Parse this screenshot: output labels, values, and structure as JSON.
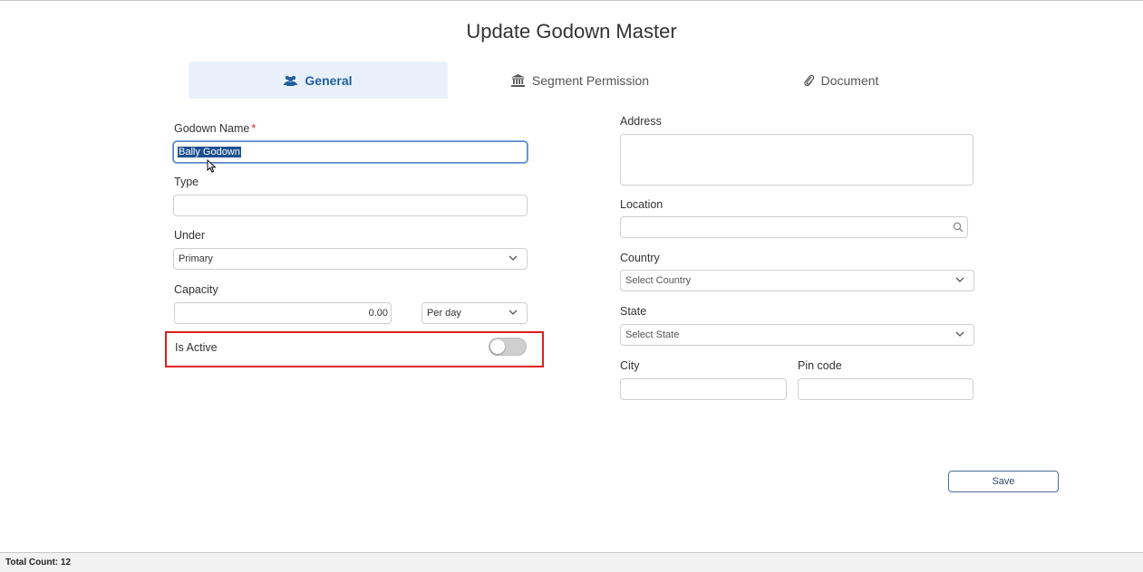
{
  "page": {
    "title": "Update Godown Master"
  },
  "tabs": [
    {
      "label": "General",
      "icon": "users-icon",
      "active": true
    },
    {
      "label": "Segment Permission",
      "icon": "bank-icon",
      "active": false
    },
    {
      "label": "Document",
      "icon": "paperclip-icon",
      "active": false
    }
  ],
  "left": {
    "godown_name": {
      "label": "Godown Name",
      "required_mark": "*",
      "value": "Bally Godown"
    },
    "type": {
      "label": "Type",
      "value": ""
    },
    "under": {
      "label": "Under",
      "value": "Primary"
    },
    "capacity": {
      "label": "Capacity",
      "value": "0.00",
      "unit": "Per day"
    },
    "is_active": {
      "label": "Is Active",
      "on": false
    }
  },
  "right": {
    "address": {
      "label": "Address",
      "value": ""
    },
    "location": {
      "label": "Location",
      "value": ""
    },
    "country": {
      "label": "Country",
      "placeholder": "Select Country"
    },
    "state": {
      "label": "State",
      "placeholder": "Select State"
    },
    "city": {
      "label": "City",
      "value": ""
    },
    "pin_code": {
      "label": "Pin code",
      "value": ""
    }
  },
  "actions": {
    "save_label": "Save"
  },
  "status": {
    "total_count": "Total Count: 12"
  },
  "colors": {
    "accent": "#1f5f9f",
    "active_tab_bg": "#e8f1fb",
    "highlight": "#e0201b"
  }
}
